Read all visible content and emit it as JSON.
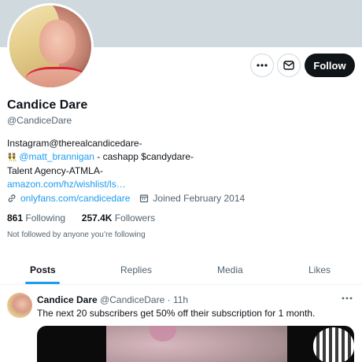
{
  "profile": {
    "name": "Candice Dare",
    "handle": "@CandiceDare",
    "bio": {
      "line1": "Instagram@therealcandicedare-",
      "line2_emoji": "👯",
      "line2_mention": "@matt_brannigan",
      "line2_rest": "- cashapp $candydare-",
      "line3": "Talent Agency-ATMLA-",
      "line4_link": "amazon.com/hz/wishlist/ls…"
    },
    "website": "onlyfans.com/candicedare",
    "joined": "Joined February 2014",
    "following_count": "861",
    "following_label": "Following",
    "followers_count": "257.4K",
    "followers_label": "Followers",
    "not_followed": "Not followed by anyone you’re following"
  },
  "actions": {
    "follow_label": "Follow",
    "more_icon": "more-icon",
    "message_icon": "envelope-icon"
  },
  "tabs": [
    "Posts",
    "Replies",
    "Media",
    "Likes"
  ],
  "active_tab": "Posts",
  "tweet": {
    "author_name": "Candice Dare",
    "author_handle": "@CandiceDare",
    "separator": "·",
    "time": "11h",
    "text": "The next 20 subscribers get 50% off their subscription for 1 month."
  },
  "colors": {
    "accent": "#1d9bf0",
    "banner": "#cfd9de",
    "follow_bg": "#0f1419",
    "text_secondary": "#536471"
  }
}
